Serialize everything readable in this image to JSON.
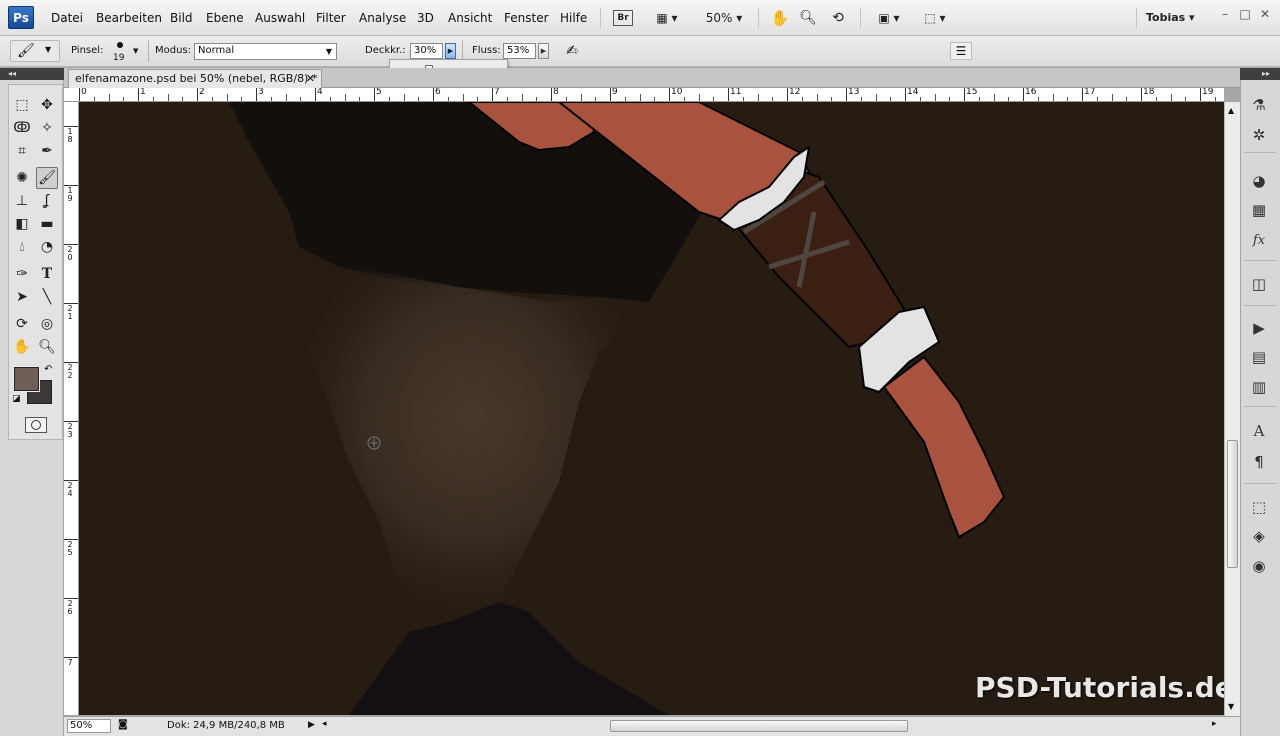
{
  "app": {
    "logo": "Ps"
  },
  "menu": [
    "Datei",
    "Bearbeiten",
    "Bild",
    "Ebene",
    "Auswahl",
    "Filter",
    "Analyse",
    "3D",
    "Ansicht",
    "Fenster",
    "Hilfe"
  ],
  "menubar_tools": {
    "bridge": "Br",
    "zoom": "50%",
    "user": "Tobias"
  },
  "options": {
    "brush_label": "Pinsel:",
    "brush_size": "19",
    "mode_label": "Modus:",
    "mode_value": "Normal",
    "opacity_label": "Deckkr.:",
    "opacity_value": "30%",
    "opacity_level": 0.3,
    "flow_label": "Fluss:",
    "flow_value": "53%"
  },
  "document": {
    "tab_title": "elfenamazone.psd bei 50% (nebel, RGB/8) *",
    "ruler_top": [
      "0",
      "1",
      "2",
      "3",
      "4",
      "5",
      "6",
      "7",
      "8",
      "9",
      "10",
      "11",
      "12",
      "13",
      "14",
      "15",
      "16",
      "17",
      "18",
      "19"
    ],
    "ruler_left": [
      "1",
      "1",
      "2",
      "2",
      "2",
      "2",
      "2",
      "2",
      "2"
    ],
    "ruler_left_sub": [
      "8",
      "9",
      "0",
      "1",
      "2",
      "3",
      "4",
      "5",
      "6",
      "7"
    ]
  },
  "status": {
    "zoom": "50%",
    "doc_info": "Dok: 24,9 MB/240,8 MB"
  },
  "watermark": "PSD-Tutorials.de",
  "colors": {
    "foreground": "#6f5d58",
    "background": "#3d3938",
    "canvas": "#261c12",
    "skin": "#a9533e"
  },
  "icons": {
    "tools": [
      "rect-marquee-icon",
      "move-icon",
      "lasso-icon",
      "magic-wand-icon",
      "crop-icon",
      "eyedropper-icon",
      "spot-heal-icon",
      "brush-icon",
      "stamp-icon",
      "history-brush-icon",
      "eraser-icon",
      "gradient-icon",
      "blur-icon",
      "dodge-icon",
      "pen-icon",
      "type-icon",
      "path-select-icon",
      "line-icon",
      "3d-rotate-icon",
      "3d-orbit-icon",
      "hand-icon",
      "zoom-icon"
    ],
    "dock": [
      "history-icon",
      "navigator-icon",
      "color-icon",
      "swatches-icon",
      "styles-icon",
      "adjustments-icon",
      "actions-icon",
      "animation-icon",
      "measurement-icon",
      "character-icon",
      "paragraph-icon",
      "transform-icon",
      "layers-icon",
      "channels-icon"
    ]
  }
}
